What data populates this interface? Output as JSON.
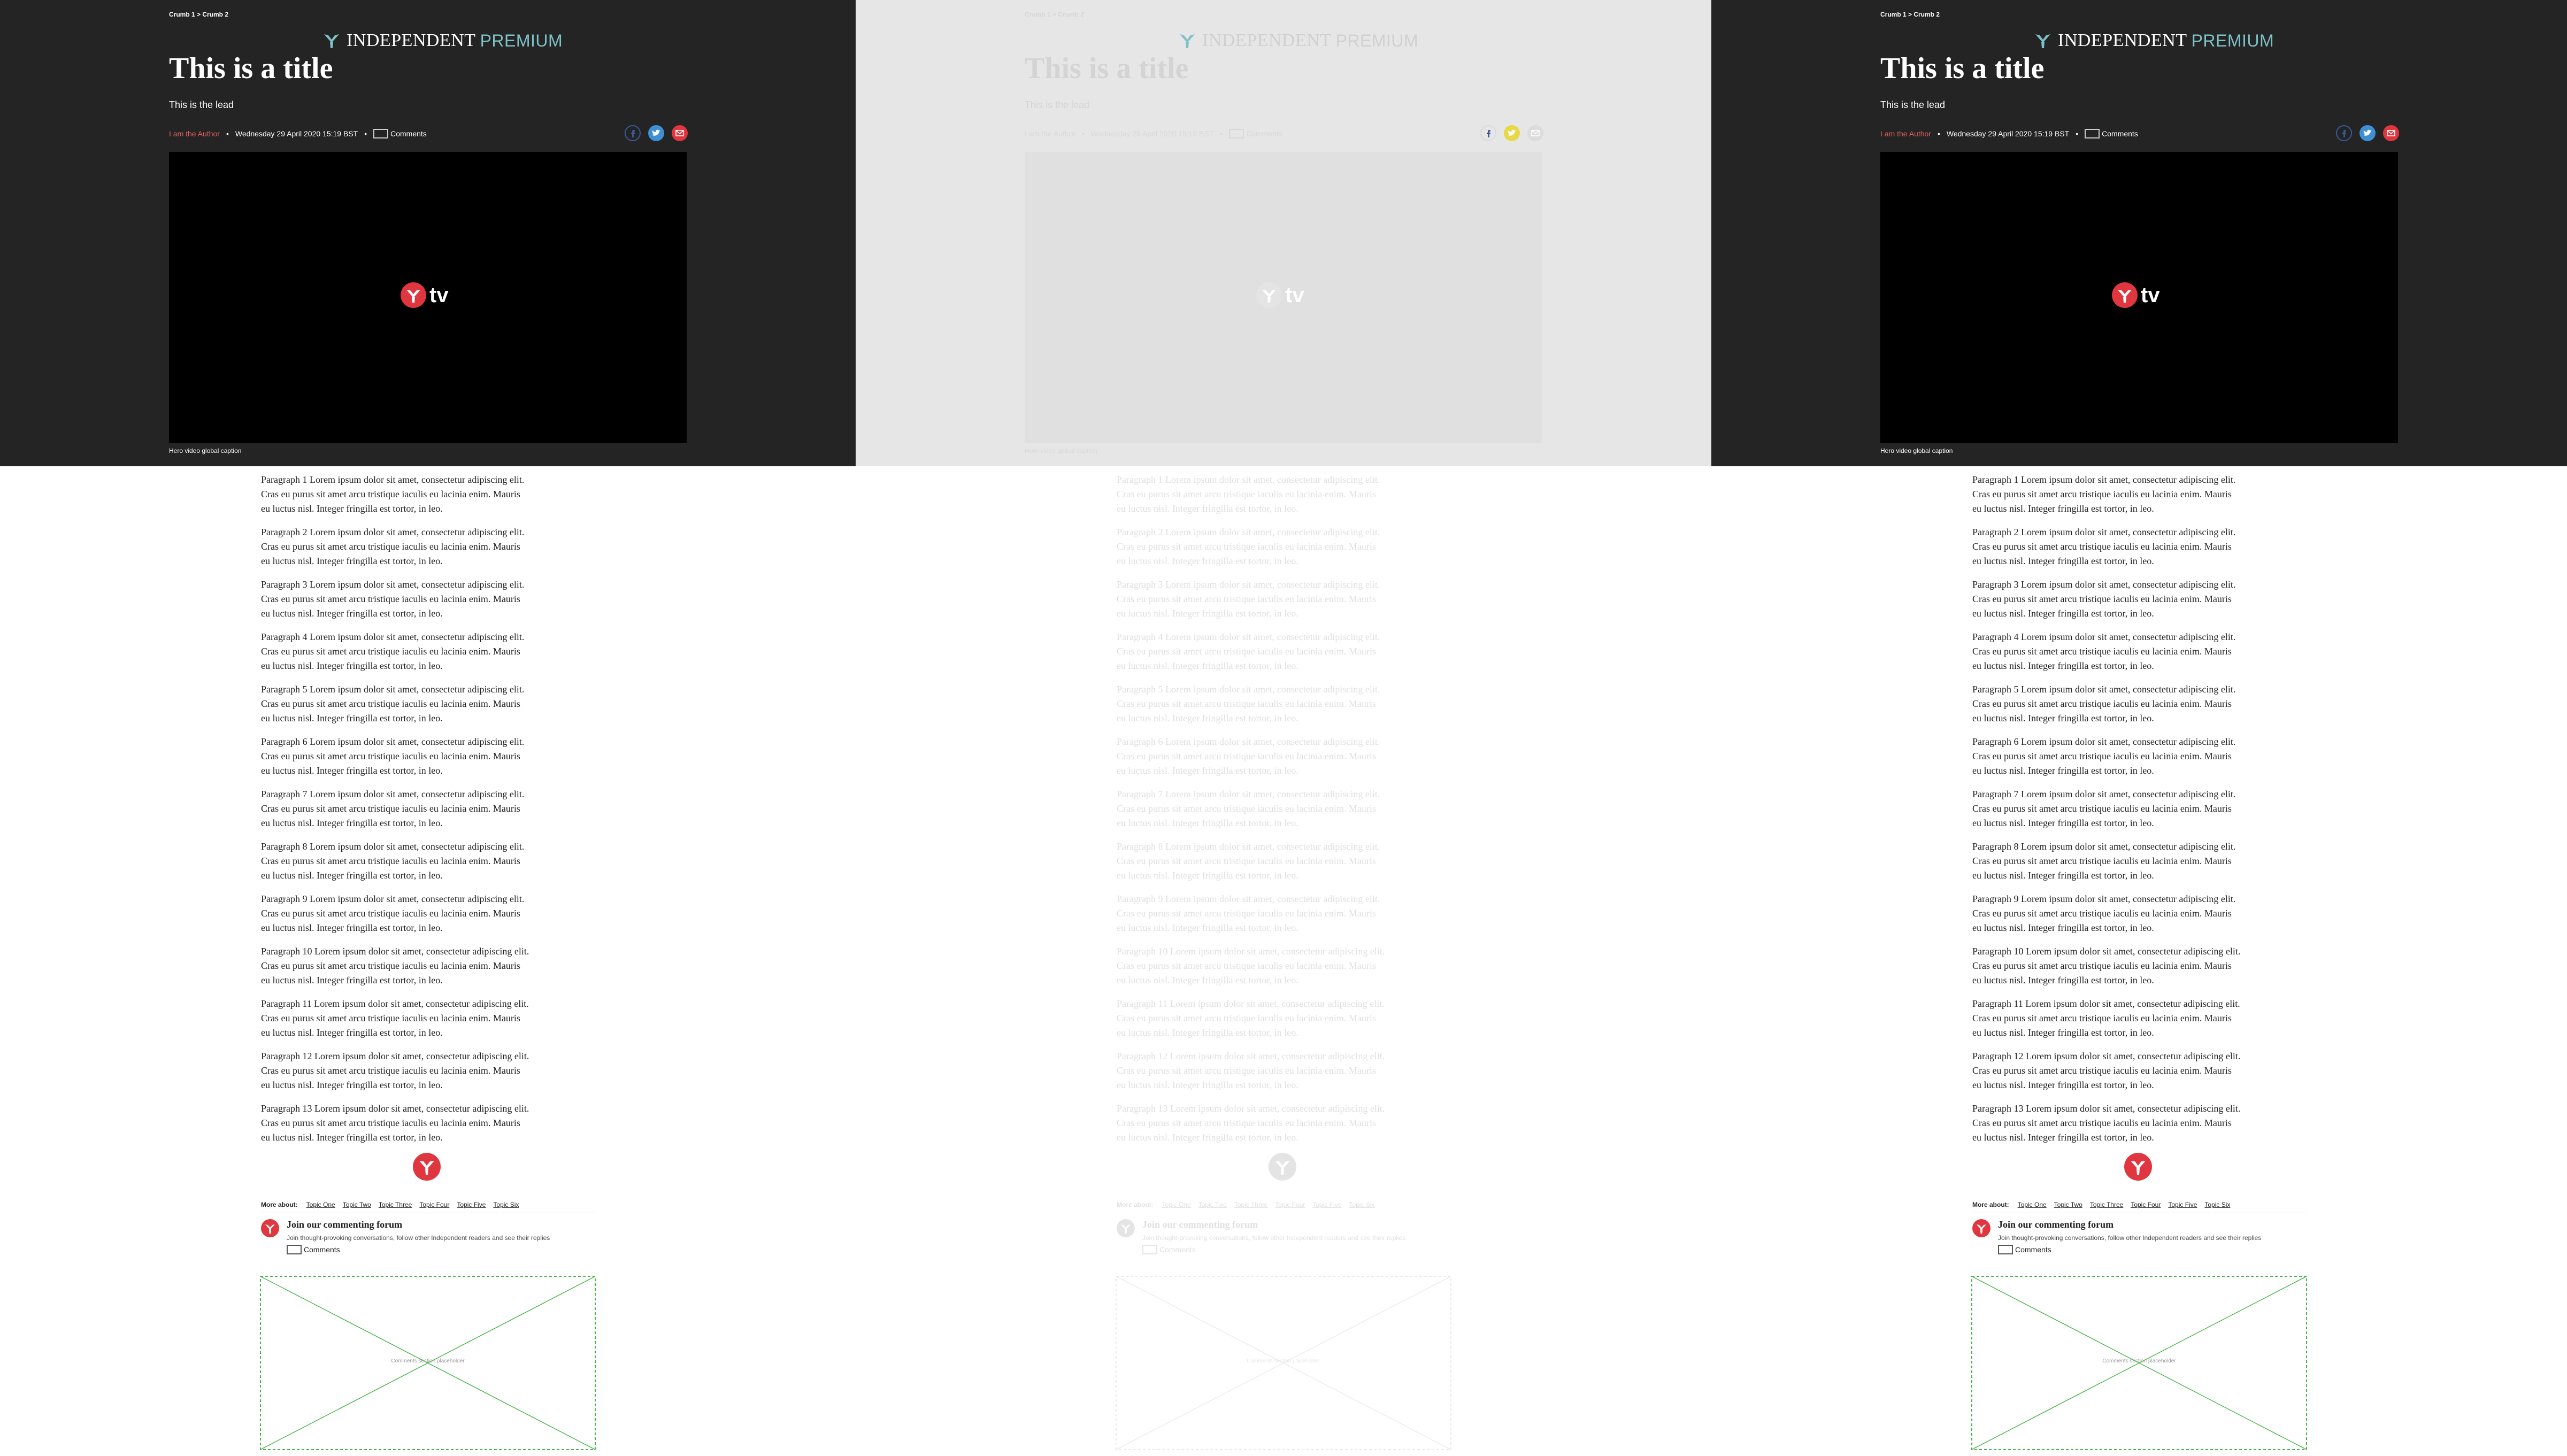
{
  "article": {
    "breadcrumb": "Crumb 1 > Crumb 2",
    "brand": {
      "name": "INDEPENDENT",
      "tier": "PREMIUM"
    },
    "title": "This is a title",
    "lead": "This is the lead",
    "author": "I am the Author",
    "date": "Wednesday 29 April 2020 15:19 BST",
    "comments_label": "Comments",
    "share": [
      "facebook-icon",
      "twitter-icon",
      "email-icon"
    ],
    "video": {
      "logo_text": "tv",
      "caption": "Hero video global caption"
    },
    "paragraphs": [
      {
        "l1": "Paragraph 1 Lorem ipsum dolor sit amet, consectetur adipiscing elit.",
        "l2": "Cras eu purus sit amet arcu tristique iaculis eu lacinia enim. Mauris",
        "l3": "eu luctus nisl. Integer fringilla est tortor, in leo."
      },
      {
        "l1": "Paragraph 2 Lorem ipsum dolor sit amet, consectetur adipiscing elit.",
        "l2": "Cras eu purus sit amet arcu tristique iaculis eu lacinia enim. Mauris",
        "l3": "eu luctus nisl. Integer fringilla est tortor, in leo."
      },
      {
        "l1": "Paragraph 3 Lorem ipsum dolor sit amet, consectetur adipiscing elit.",
        "l2": "Cras eu purus sit amet arcu tristique iaculis eu lacinia enim. Mauris",
        "l3": "eu luctus nisl. Integer fringilla est tortor, in leo."
      },
      {
        "l1": "Paragraph 4 Lorem ipsum dolor sit amet, consectetur adipiscing elit.",
        "l2": "Cras eu purus sit amet arcu tristique iaculis eu lacinia enim. Mauris",
        "l3": "eu luctus nisl. Integer fringilla est tortor, in leo."
      },
      {
        "l1": "Paragraph 5 Lorem ipsum dolor sit amet, consectetur adipiscing elit.",
        "l2": "Cras eu purus sit amet arcu tristique iaculis eu lacinia enim. Mauris",
        "l3": "eu luctus nisl. Integer fringilla est tortor, in leo."
      },
      {
        "l1": "Paragraph 6 Lorem ipsum dolor sit amet, consectetur adipiscing elit.",
        "l2": "Cras eu purus sit amet arcu tristique iaculis eu lacinia enim. Mauris",
        "l3": "eu luctus nisl. Integer fringilla est tortor, in leo."
      },
      {
        "l1": "Paragraph 7 Lorem ipsum dolor sit amet, consectetur adipiscing elit.",
        "l2": "Cras eu purus sit amet arcu tristique iaculis eu lacinia enim. Mauris",
        "l3": "eu luctus nisl. Integer fringilla est tortor, in leo."
      },
      {
        "l1": "Paragraph 8 Lorem ipsum dolor sit amet, consectetur adipiscing elit.",
        "l2": "Cras eu purus sit amet arcu tristique iaculis eu lacinia enim. Mauris",
        "l3": "eu luctus nisl. Integer fringilla est tortor, in leo."
      },
      {
        "l1": "Paragraph 9 Lorem ipsum dolor sit amet, consectetur adipiscing elit.",
        "l2": "Cras eu purus sit amet arcu tristique iaculis eu lacinia enim. Mauris",
        "l3": "eu luctus nisl. Integer fringilla est tortor, in leo."
      },
      {
        "l1": "Paragraph 10 Lorem ipsum dolor sit amet, consectetur adipiscing elit.",
        "l2": "Cras eu purus sit amet arcu tristique iaculis eu lacinia enim. Mauris",
        "l3": "eu luctus nisl. Integer fringilla est tortor, in leo."
      },
      {
        "l1": "Paragraph 11 Lorem ipsum dolor sit amet, consectetur adipiscing elit.",
        "l2": "Cras eu purus sit amet arcu tristique iaculis eu lacinia enim. Mauris",
        "l3": "eu luctus nisl. Integer fringilla est tortor, in leo."
      },
      {
        "l1": "Paragraph 12 Lorem ipsum dolor sit amet, consectetur adipiscing elit.",
        "l2": "Cras eu purus sit amet arcu tristique iaculis eu lacinia enim. Mauris",
        "l3": "eu luctus nisl. Integer fringilla est tortor, in leo."
      },
      {
        "l1": "Paragraph 13 Lorem ipsum dolor sit amet, consectetur adipiscing elit.",
        "l2": "Cras eu purus sit amet arcu tristique iaculis eu lacinia enim. Mauris",
        "l3": "eu luctus nisl. Integer fringilla est tortor, in leo."
      }
    ],
    "more_about": {
      "label": "More about:",
      "topics": [
        "Topic One",
        "Topic Two",
        "Topic Three",
        "Topic Four",
        "Topic Five",
        "Topic Six"
      ]
    },
    "forum": {
      "title": "Join our commenting forum",
      "description": "Join thought-provoking conversations, follow other Independent readers and see their replies",
      "comments_label": "Comments"
    },
    "placeholder_label": "Comments section placeholder"
  },
  "colors": {
    "hero_dark": "#242424",
    "hero_faded": "#e6e6e6",
    "brand_red": "#e0363f",
    "premium_teal": "#7ec1c6",
    "author_red": "#e05d5d",
    "twitter_blue": "#3f8fd6",
    "placeholder_green": "#44b544"
  }
}
